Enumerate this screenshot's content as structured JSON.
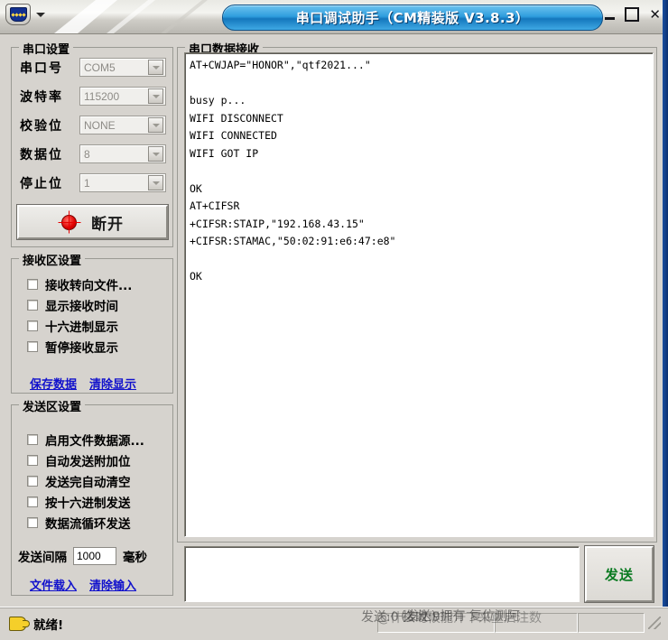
{
  "window": {
    "title": "串口调试助手（CM精装版 V3.8.3）",
    "app_icon": "shield-crest-icon",
    "menu_arrow_icon": "chevron-down-icon",
    "minimize_label": "–",
    "maximize_label": "□",
    "close_label": "✕"
  },
  "serial_settings": {
    "legend": "串口设置",
    "fields": [
      {
        "label": "串口号",
        "value": "COM5"
      },
      {
        "label": "波特率",
        "value": "115200"
      },
      {
        "label": "校验位",
        "value": "NONE"
      },
      {
        "label": "数据位",
        "value": "8"
      },
      {
        "label": "停止位",
        "value": "1"
      }
    ],
    "connect_button": "断开",
    "connect_led_color": "#e00000"
  },
  "receive_settings": {
    "legend": "接收区设置",
    "checkboxes": [
      {
        "label": "接收转向文件...",
        "checked": false
      },
      {
        "label": "显示接收时间",
        "checked": false
      },
      {
        "label": "十六进制显示",
        "checked": false
      },
      {
        "label": "暂停接收显示",
        "checked": false
      }
    ],
    "links": [
      {
        "label": "保存数据"
      },
      {
        "label": "清除显示"
      }
    ]
  },
  "send_settings": {
    "legend": "发送区设置",
    "checkboxes": [
      {
        "label": "启用文件数据源...",
        "checked": false
      },
      {
        "label": "自动发送附加位",
        "checked": false
      },
      {
        "label": "发送完自动清空",
        "checked": false
      },
      {
        "label": "按十六进制发送",
        "checked": false
      },
      {
        "label": "数据流循环发送",
        "checked": false
      }
    ],
    "interval_label": "发送间隔",
    "interval_value": "1000",
    "interval_unit": "毫秒",
    "links": [
      {
        "label": "文件载入"
      },
      {
        "label": "清除输入"
      }
    ]
  },
  "receive_area": {
    "legend": "串口数据接收",
    "content": "AT+CWJAP=\"HONOR\",\"qtf2021...\"\n\nbusy p...\nWIFI DISCONNECT\nWIFI CONNECTED\nWIFI GOT IP\n\nOK\nAT+CIFSR\n+CIFSR:STAIP,\"192.168.43.15\"\n+CIFSR:STAMAC,\"50:02:91:e6:47:e8\"\n\nOK"
  },
  "send_area": {
    "input_value": "",
    "send_button": "发送"
  },
  "statusbar": {
    "icon": "pointing-hand-icon",
    "text": "就绪!",
    "watermark_lines": [
      "发送:0       接收:9",
      "@什么时候能汗下来重启注数",
      "(发送)  拥有  复位测阿"
    ]
  }
}
